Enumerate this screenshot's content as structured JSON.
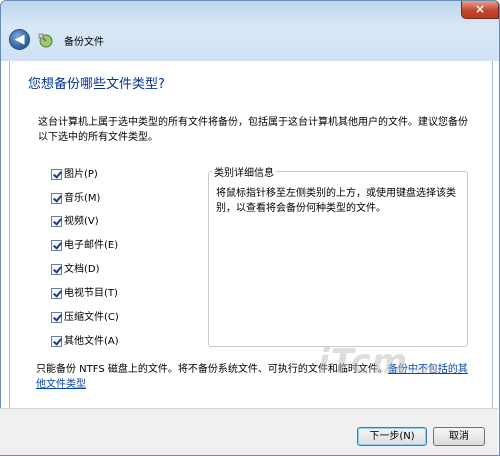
{
  "window": {
    "title": "备份文件",
    "close_glyph": "×",
    "back_glyph": "◀"
  },
  "main": {
    "heading": "您想备份哪些文件类型?",
    "description": "这台计算机上属于选中类型的所有文件将备份，包括属于这台计算机其他用户的文件。建议您备份以下选中的所有文件类型。",
    "file_types": [
      {
        "label": "图片(P)",
        "checked": true
      },
      {
        "label": "音乐(M)",
        "checked": true
      },
      {
        "label": "视频(V)",
        "checked": true
      },
      {
        "label": "电子邮件(E)",
        "checked": true
      },
      {
        "label": "文档(D)",
        "checked": true
      },
      {
        "label": "电视节目(T)",
        "checked": true
      },
      {
        "label": "压缩文件(C)",
        "checked": true
      },
      {
        "label": "其他文件(A)",
        "checked": true
      }
    ],
    "details": {
      "legend": "类别详细信息",
      "text": "将鼠标指针移至左侧类别的上方，或使用键盘选择该类别，以查看将会备份何种类型的文件。"
    },
    "footer": {
      "text": "只能备份 NTFS 磁盘上的文件。将不备份系统文件、可执行的文件和临时文件。",
      "link": "备份中不包括的其他文件类型"
    }
  },
  "buttons": {
    "next": "下一步(N)",
    "cancel": "取消"
  },
  "watermark": {
    "main": "iTcm",
    "suffix": ".cn"
  },
  "colors": {
    "heading": "#003399",
    "link": "#0645ad",
    "titlebar": "#cfe1f3"
  }
}
